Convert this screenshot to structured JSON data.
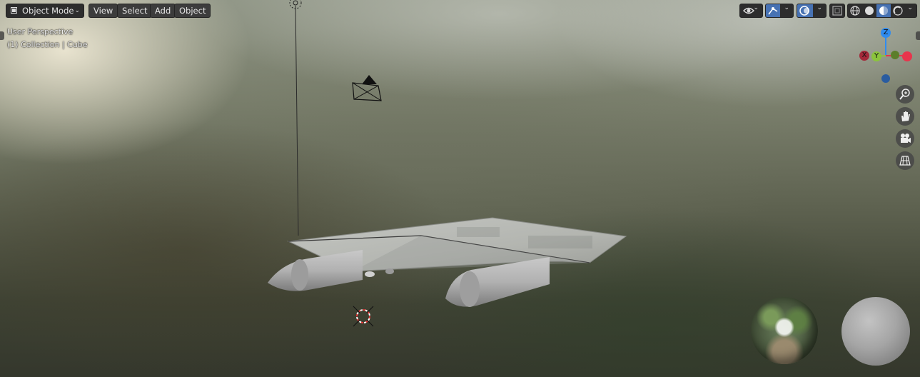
{
  "header": {
    "mode_label": "Object Mode",
    "menus": [
      "View",
      "Select",
      "Add",
      "Object"
    ]
  },
  "overlay": {
    "perspective_text": "User Perspective",
    "collection_text": "(1) Collection | Cube"
  },
  "gizmo": {
    "axis_labels": {
      "x": "X",
      "y": "Y",
      "z": "Z"
    },
    "colors": {
      "x": "#e8344c",
      "y": "#8bc43c",
      "z": "#2f8cf0",
      "x_neg": "#a3293a",
      "y_neg": "#5c7e2a",
      "z_neg": "#2a5ca0"
    }
  },
  "nav_buttons": [
    "zoom-icon",
    "hand-pan-icon",
    "camera-view-icon",
    "grid-ortho-icon"
  ],
  "header_right": {
    "visibility_icon": "eye-icon",
    "gizmo_toggle_icon": "gizmo-icon",
    "overlay_toggle_icon": "overlay-icon",
    "xray_icon": "xray-icon",
    "shading_modes": [
      "wireframe-icon",
      "solid-icon",
      "material-preview-icon",
      "rendered-icon"
    ],
    "active_shading": "material-preview-icon"
  },
  "colors": {
    "accent": "#4772b3",
    "header_bg": "#2d2d2d",
    "button_bg": "#3c3c3c"
  }
}
